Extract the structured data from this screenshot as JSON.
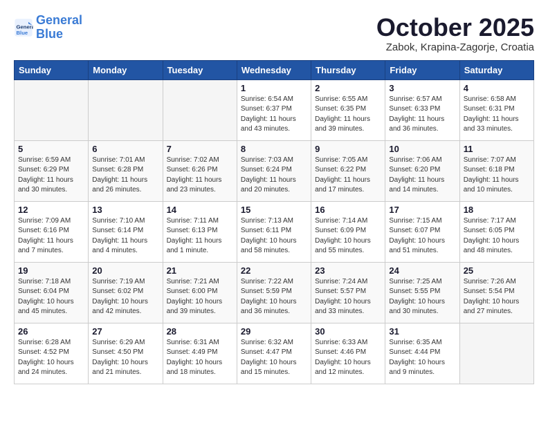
{
  "header": {
    "logo_line1": "General",
    "logo_line2": "Blue",
    "title": "October 2025",
    "subtitle": "Zabok, Krapina-Zagorje, Croatia"
  },
  "days_of_week": [
    "Sunday",
    "Monday",
    "Tuesday",
    "Wednesday",
    "Thursday",
    "Friday",
    "Saturday"
  ],
  "weeks": [
    [
      {
        "day": "",
        "sunrise": "",
        "sunset": "",
        "daylight": "",
        "empty": true
      },
      {
        "day": "",
        "sunrise": "",
        "sunset": "",
        "daylight": "",
        "empty": true
      },
      {
        "day": "",
        "sunrise": "",
        "sunset": "",
        "daylight": "",
        "empty": true
      },
      {
        "day": "1",
        "sunrise": "Sunrise: 6:54 AM",
        "sunset": "Sunset: 6:37 PM",
        "daylight": "Daylight: 11 hours and 43 minutes."
      },
      {
        "day": "2",
        "sunrise": "Sunrise: 6:55 AM",
        "sunset": "Sunset: 6:35 PM",
        "daylight": "Daylight: 11 hours and 39 minutes."
      },
      {
        "day": "3",
        "sunrise": "Sunrise: 6:57 AM",
        "sunset": "Sunset: 6:33 PM",
        "daylight": "Daylight: 11 hours and 36 minutes."
      },
      {
        "day": "4",
        "sunrise": "Sunrise: 6:58 AM",
        "sunset": "Sunset: 6:31 PM",
        "daylight": "Daylight: 11 hours and 33 minutes."
      }
    ],
    [
      {
        "day": "5",
        "sunrise": "Sunrise: 6:59 AM",
        "sunset": "Sunset: 6:29 PM",
        "daylight": "Daylight: 11 hours and 30 minutes."
      },
      {
        "day": "6",
        "sunrise": "Sunrise: 7:01 AM",
        "sunset": "Sunset: 6:28 PM",
        "daylight": "Daylight: 11 hours and 26 minutes."
      },
      {
        "day": "7",
        "sunrise": "Sunrise: 7:02 AM",
        "sunset": "Sunset: 6:26 PM",
        "daylight": "Daylight: 11 hours and 23 minutes."
      },
      {
        "day": "8",
        "sunrise": "Sunrise: 7:03 AM",
        "sunset": "Sunset: 6:24 PM",
        "daylight": "Daylight: 11 hours and 20 minutes."
      },
      {
        "day": "9",
        "sunrise": "Sunrise: 7:05 AM",
        "sunset": "Sunset: 6:22 PM",
        "daylight": "Daylight: 11 hours and 17 minutes."
      },
      {
        "day": "10",
        "sunrise": "Sunrise: 7:06 AM",
        "sunset": "Sunset: 6:20 PM",
        "daylight": "Daylight: 11 hours and 14 minutes."
      },
      {
        "day": "11",
        "sunrise": "Sunrise: 7:07 AM",
        "sunset": "Sunset: 6:18 PM",
        "daylight": "Daylight: 11 hours and 10 minutes."
      }
    ],
    [
      {
        "day": "12",
        "sunrise": "Sunrise: 7:09 AM",
        "sunset": "Sunset: 6:16 PM",
        "daylight": "Daylight: 11 hours and 7 minutes."
      },
      {
        "day": "13",
        "sunrise": "Sunrise: 7:10 AM",
        "sunset": "Sunset: 6:14 PM",
        "daylight": "Daylight: 11 hours and 4 minutes."
      },
      {
        "day": "14",
        "sunrise": "Sunrise: 7:11 AM",
        "sunset": "Sunset: 6:13 PM",
        "daylight": "Daylight: 11 hours and 1 minute."
      },
      {
        "day": "15",
        "sunrise": "Sunrise: 7:13 AM",
        "sunset": "Sunset: 6:11 PM",
        "daylight": "Daylight: 10 hours and 58 minutes."
      },
      {
        "day": "16",
        "sunrise": "Sunrise: 7:14 AM",
        "sunset": "Sunset: 6:09 PM",
        "daylight": "Daylight: 10 hours and 55 minutes."
      },
      {
        "day": "17",
        "sunrise": "Sunrise: 7:15 AM",
        "sunset": "Sunset: 6:07 PM",
        "daylight": "Daylight: 10 hours and 51 minutes."
      },
      {
        "day": "18",
        "sunrise": "Sunrise: 7:17 AM",
        "sunset": "Sunset: 6:05 PM",
        "daylight": "Daylight: 10 hours and 48 minutes."
      }
    ],
    [
      {
        "day": "19",
        "sunrise": "Sunrise: 7:18 AM",
        "sunset": "Sunset: 6:04 PM",
        "daylight": "Daylight: 10 hours and 45 minutes."
      },
      {
        "day": "20",
        "sunrise": "Sunrise: 7:19 AM",
        "sunset": "Sunset: 6:02 PM",
        "daylight": "Daylight: 10 hours and 42 minutes."
      },
      {
        "day": "21",
        "sunrise": "Sunrise: 7:21 AM",
        "sunset": "Sunset: 6:00 PM",
        "daylight": "Daylight: 10 hours and 39 minutes."
      },
      {
        "day": "22",
        "sunrise": "Sunrise: 7:22 AM",
        "sunset": "Sunset: 5:59 PM",
        "daylight": "Daylight: 10 hours and 36 minutes."
      },
      {
        "day": "23",
        "sunrise": "Sunrise: 7:24 AM",
        "sunset": "Sunset: 5:57 PM",
        "daylight": "Daylight: 10 hours and 33 minutes."
      },
      {
        "day": "24",
        "sunrise": "Sunrise: 7:25 AM",
        "sunset": "Sunset: 5:55 PM",
        "daylight": "Daylight: 10 hours and 30 minutes."
      },
      {
        "day": "25",
        "sunrise": "Sunrise: 7:26 AM",
        "sunset": "Sunset: 5:54 PM",
        "daylight": "Daylight: 10 hours and 27 minutes."
      }
    ],
    [
      {
        "day": "26",
        "sunrise": "Sunrise: 6:28 AM",
        "sunset": "Sunset: 4:52 PM",
        "daylight": "Daylight: 10 hours and 24 minutes."
      },
      {
        "day": "27",
        "sunrise": "Sunrise: 6:29 AM",
        "sunset": "Sunset: 4:50 PM",
        "daylight": "Daylight: 10 hours and 21 minutes."
      },
      {
        "day": "28",
        "sunrise": "Sunrise: 6:31 AM",
        "sunset": "Sunset: 4:49 PM",
        "daylight": "Daylight: 10 hours and 18 minutes."
      },
      {
        "day": "29",
        "sunrise": "Sunrise: 6:32 AM",
        "sunset": "Sunset: 4:47 PM",
        "daylight": "Daylight: 10 hours and 15 minutes."
      },
      {
        "day": "30",
        "sunrise": "Sunrise: 6:33 AM",
        "sunset": "Sunset: 4:46 PM",
        "daylight": "Daylight: 10 hours and 12 minutes."
      },
      {
        "day": "31",
        "sunrise": "Sunrise: 6:35 AM",
        "sunset": "Sunset: 4:44 PM",
        "daylight": "Daylight: 10 hours and 9 minutes."
      },
      {
        "day": "",
        "sunrise": "",
        "sunset": "",
        "daylight": "",
        "empty": true
      }
    ]
  ]
}
